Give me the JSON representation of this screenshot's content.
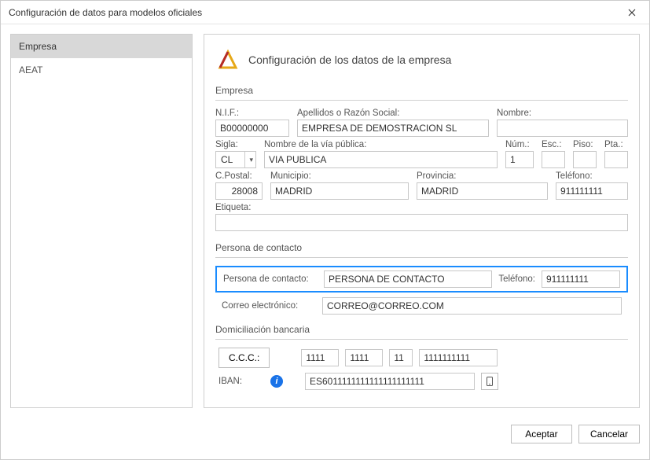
{
  "window": {
    "title": "Configuración de datos para modelos oficiales"
  },
  "sidebar": {
    "items": [
      {
        "label": "Empresa",
        "selected": true
      },
      {
        "label": "AEAT",
        "selected": false
      }
    ]
  },
  "header": {
    "title": "Configuración de los datos de la empresa"
  },
  "sections": {
    "empresa": {
      "title": "Empresa",
      "nif_label": "N.I.F.:",
      "nif": "B00000000",
      "apellidos_label": "Apellidos o Razón Social:",
      "apellidos": "EMPRESA DE DEMOSTRACION SL",
      "nombre_label": "Nombre:",
      "nombre": "",
      "sigla_label": "Sigla:",
      "sigla": "CL",
      "via_label": "Nombre de la vía pública:",
      "via": "VIA PUBLICA",
      "num_label": "Núm.:",
      "num": "1",
      "esc_label": "Esc.:",
      "esc": "",
      "piso_label": "Piso:",
      "piso": "",
      "pta_label": "Pta.:",
      "pta": "",
      "cpostal_label": "C.Postal:",
      "cpostal": "28008",
      "municipio_label": "Municipio:",
      "municipio": "MADRID",
      "provincia_label": "Provincia:",
      "provincia": "MADRID",
      "telefono_label": "Teléfono:",
      "telefono": "911111111",
      "etiqueta_label": "Etiqueta:",
      "etiqueta": ""
    },
    "contacto": {
      "title": "Persona de contacto",
      "persona_label": "Persona de contacto:",
      "persona": "PERSONA DE CONTACTO",
      "telefono_label": "Teléfono:",
      "telefono": "911111111",
      "correo_label": "Correo electrónico:",
      "correo": "CORREO@CORREO.COM"
    },
    "banco": {
      "title": "Domiciliación bancaria",
      "ccc_label": "C.C.C.:",
      "ccc1": "1111",
      "ccc2": "1111",
      "ccc3": "11",
      "ccc4": "1111111111",
      "iban_label": "IBAN:",
      "iban": "ES6011111111111111111111"
    }
  },
  "footer": {
    "accept": "Aceptar",
    "cancel": "Cancelar"
  }
}
